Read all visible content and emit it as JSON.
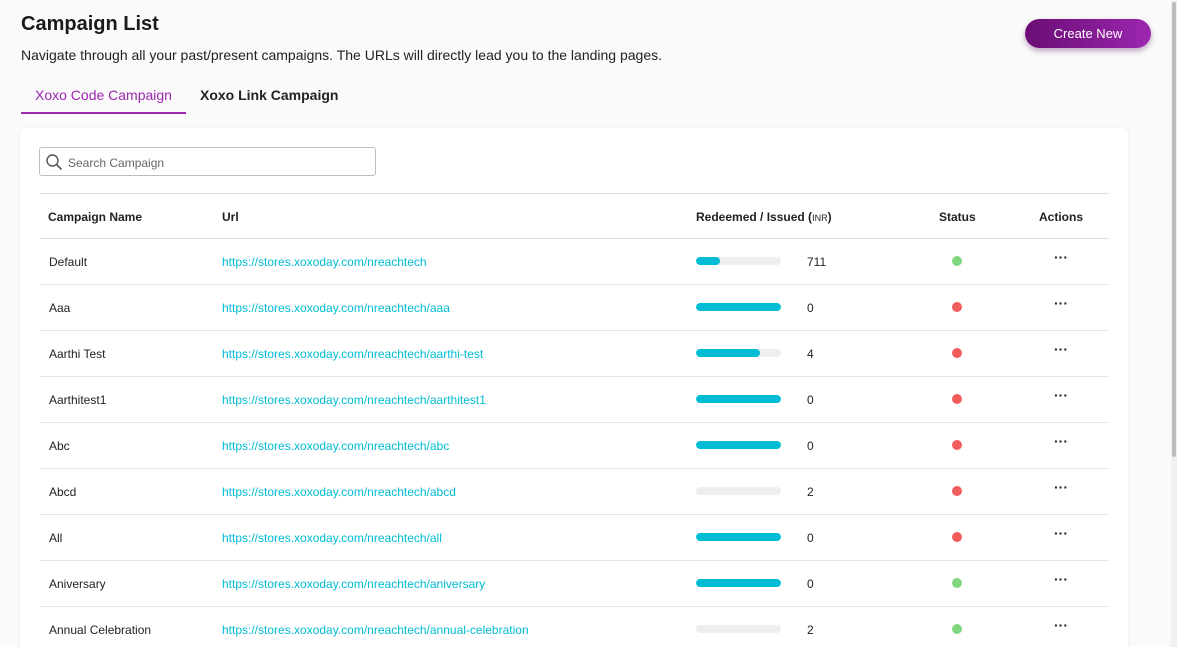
{
  "header": {
    "title": "Campaign List",
    "subtitle": "Navigate through all your past/present campaigns. The URLs will directly lead you to the landing pages.",
    "create_label": "Create New"
  },
  "tabs": [
    {
      "label": "Xoxo Code Campaign",
      "active": true
    },
    {
      "label": "Xoxo Link Campaign",
      "active": false
    }
  ],
  "search": {
    "placeholder": "Search Campaign",
    "icon": "search-icon"
  },
  "table": {
    "columns": {
      "name": "Campaign Name",
      "url": "Url",
      "redeemed": "Redeemed / Issued",
      "currency": "INR",
      "status": "Status",
      "actions": "Actions"
    },
    "actions_glyph": "···",
    "rows": [
      {
        "name": "Default",
        "url": "https://stores.xoxoday.com/nreachtech",
        "redeemed_fraction": 0.28,
        "count": "711",
        "status": "active"
      },
      {
        "name": "Aaa",
        "url": "https://stores.xoxoday.com/nreachtech/aaa",
        "redeemed_fraction": 1.0,
        "count": "0",
        "status": "inactive"
      },
      {
        "name": "Aarthi Test",
        "url": "https://stores.xoxoday.com/nreachtech/aarthi-test",
        "redeemed_fraction": 0.75,
        "count": "4",
        "status": "inactive"
      },
      {
        "name": "Aarthitest1",
        "url": "https://stores.xoxoday.com/nreachtech/aarthitest1",
        "redeemed_fraction": 1.0,
        "count": "0",
        "status": "inactive"
      },
      {
        "name": "Abc",
        "url": "https://stores.xoxoday.com/nreachtech/abc",
        "redeemed_fraction": 1.0,
        "count": "0",
        "status": "inactive"
      },
      {
        "name": "Abcd",
        "url": "https://stores.xoxoday.com/nreachtech/abcd",
        "redeemed_fraction": 0.0,
        "count": "2",
        "status": "inactive"
      },
      {
        "name": "All",
        "url": "https://stores.xoxoday.com/nreachtech/all",
        "redeemed_fraction": 1.0,
        "count": "0",
        "status": "inactive"
      },
      {
        "name": "Aniversary",
        "url": "https://stores.xoxoday.com/nreachtech/aniversary",
        "redeemed_fraction": 1.0,
        "count": "0",
        "status": "active"
      },
      {
        "name": "Annual Celebration",
        "url": "https://stores.xoxoday.com/nreachtech/annual-celebration",
        "redeemed_fraction": 0.0,
        "count": "2",
        "status": "active"
      }
    ]
  },
  "colors": {
    "accent": "#9c27b0",
    "link": "#00bcd4",
    "status_active": "#81d67f",
    "status_inactive": "#f25c5c"
  }
}
